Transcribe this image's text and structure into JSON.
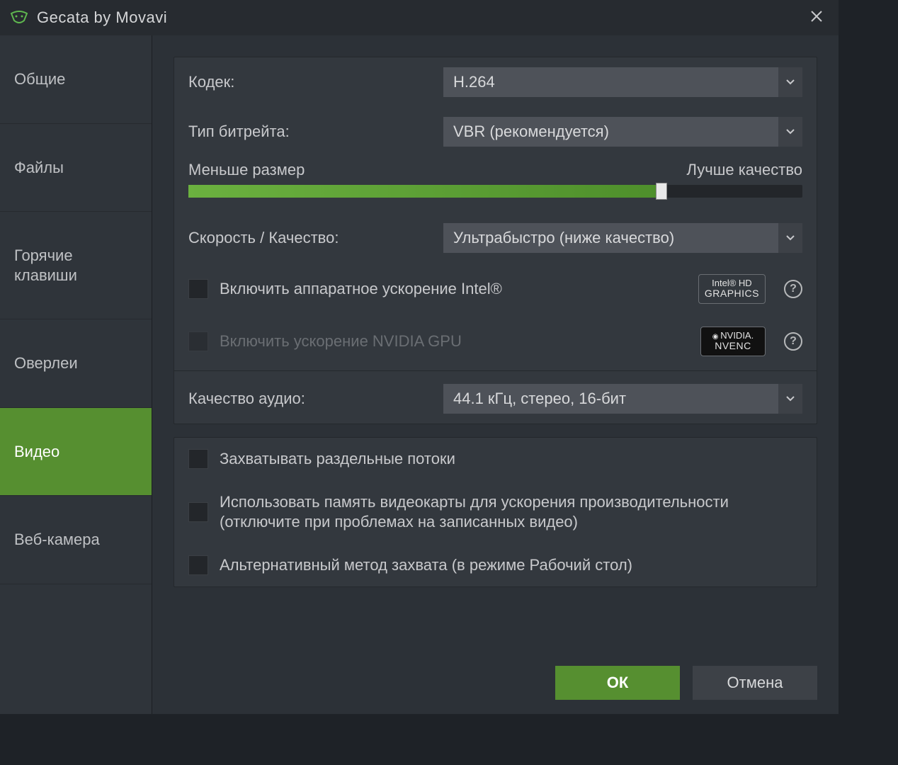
{
  "window": {
    "title": "Gecata by Movavi"
  },
  "sidebar": {
    "items": [
      {
        "label": "Общие"
      },
      {
        "label": "Файлы"
      },
      {
        "label": "Горячие клавиши"
      },
      {
        "label": "Оверлеи"
      },
      {
        "label": "Видео"
      },
      {
        "label": "Веб-камера"
      }
    ],
    "active_index": 4
  },
  "video": {
    "codec_label": "Кодек:",
    "codec_value": "H.264",
    "bitrate_type_label": "Тип битрейта:",
    "bitrate_type_value": "VBR (рекомендуется)",
    "slider_left": "Меньше размер",
    "slider_right": "Лучше качество",
    "slider_percent": 77,
    "speed_quality_label": "Скорость / Качество:",
    "speed_quality_value": "Ультрабыстро (ниже качество)",
    "hw_intel_label": "Включить аппаратное ускорение Intel®",
    "hw_intel_checked": false,
    "hw_nvidia_label": "Включить ускорение NVIDIA GPU",
    "hw_nvidia_checked": false,
    "hw_nvidia_disabled": true,
    "intel_badge_top": "Intel® HD",
    "intel_badge_bot": "GRAPHICS",
    "nvidia_badge_top": "NVIDIA.",
    "nvidia_badge_bot": "NVENC",
    "audio_quality_label": "Качество аудио:",
    "audio_quality_value": "44.1 кГц, стерео, 16-бит",
    "capture_separate_label": "Захватывать раздельные потоки",
    "capture_separate_checked": false,
    "gpu_memory_label": "Использовать память видеокарты для ускорения производительности (отключите при проблемах на записанных видео)",
    "gpu_memory_checked": false,
    "alt_capture_label": "Альтернативный метод захвата (в режиме Рабочий стол)",
    "alt_capture_checked": false
  },
  "footer": {
    "ok": "ОК",
    "cancel": "Отмена"
  },
  "colors": {
    "accent": "#568f30",
    "bg": "#2c3137",
    "panel": "#33383e",
    "select": "#4e5259"
  }
}
